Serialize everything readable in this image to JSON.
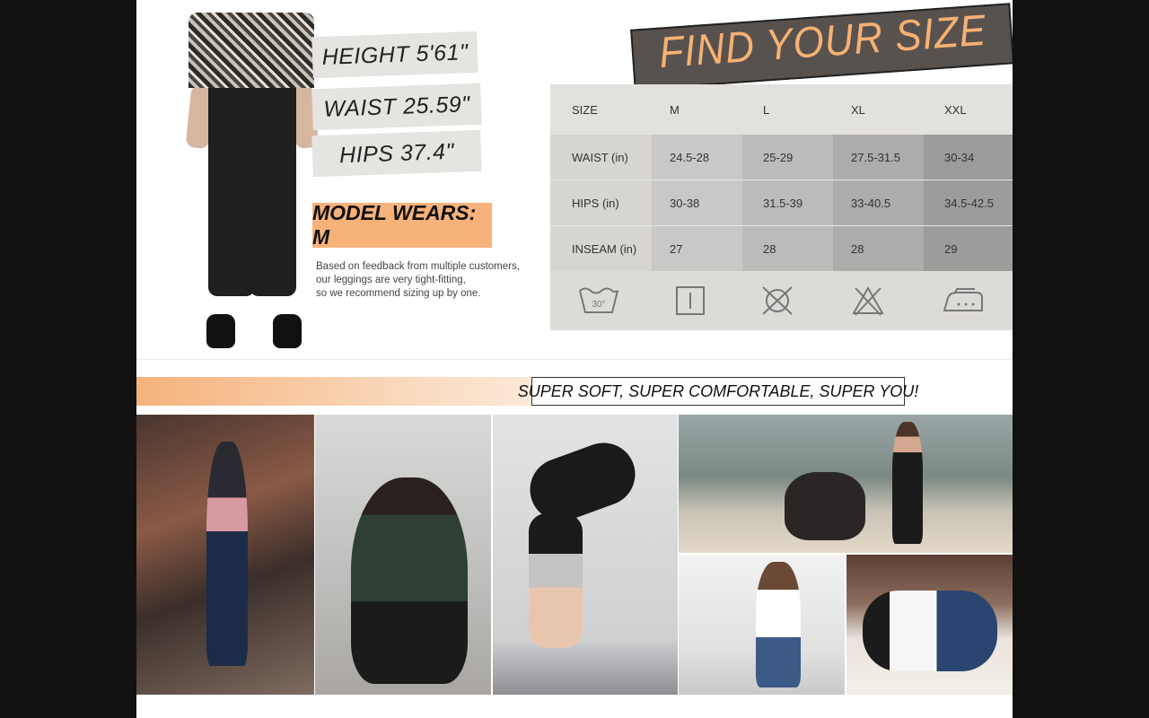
{
  "measurements": {
    "height": "HEIGHT 5'61\"",
    "waist": "WAIST 25.59\"",
    "hips": "HIPS 37.4\""
  },
  "model_wears": "MODEL WEARS: M",
  "note_lines": [
    "Based on feedback from multiple customers,",
    "our leggings are very tight-fitting,",
    "so we recommend sizing up by one."
  ],
  "banner_title": "FIND YOUR SIZE",
  "size_table": {
    "header": {
      "label": "SIZE",
      "c1": "M",
      "c2": "L",
      "c3": "XL",
      "c4": "XXL"
    },
    "rows": [
      {
        "label": "WAIST (in)",
        "c1": "24.5-28",
        "c2": "25-29",
        "c3": "27.5-31.5",
        "c4": "30-34"
      },
      {
        "label": "HIPS (in)",
        "c1": "30-38",
        "c2": "31.5-39",
        "c3": "33-40.5",
        "c4": "34.5-42.5"
      },
      {
        "label": "INSEAM (in)",
        "c1": "27",
        "c2": "28",
        "c3": "28",
        "c4": "29"
      }
    ]
  },
  "care_icons": [
    "wash-30-icon",
    "tumble-dry-icon",
    "do-not-dry-clean-icon",
    "do-not-bleach-icon",
    "iron-icon"
  ],
  "wash_temp": "30°",
  "slogan": "SUPER SOFT, SUPER COMFORTABLE, SUPER YOU!",
  "colors": {
    "accent_orange": "#f7b27a",
    "banner_text": "#f6b173",
    "banner_bg": "#58524f"
  }
}
